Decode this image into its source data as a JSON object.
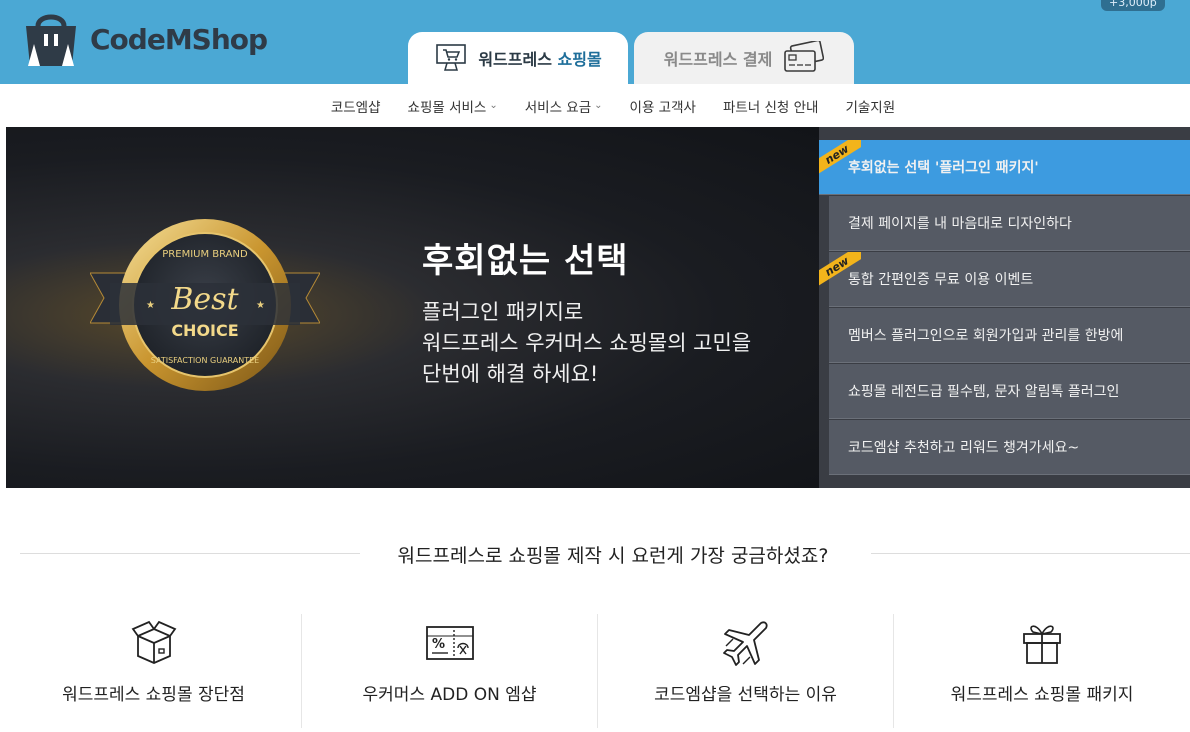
{
  "header": {
    "logo_text": "CodeMShop",
    "points_badge": "+3,000p",
    "tabs": [
      {
        "label_main": "워드프레스 ",
        "label_accent": "쇼핑몰",
        "icon": "shopping-cart-monitor-icon",
        "active": true
      },
      {
        "label_main": "워드프레스 결제",
        "icon": "payment-card-icon",
        "active": false
      }
    ]
  },
  "nav": {
    "items": [
      {
        "label": "코드엠샵",
        "dropdown": false
      },
      {
        "label": "쇼핑몰 서비스",
        "dropdown": true
      },
      {
        "label": "서비스 요금",
        "dropdown": true
      },
      {
        "label": "이용 고객사",
        "dropdown": false
      },
      {
        "label": "파트너 신청 안내",
        "dropdown": false
      },
      {
        "label": "기술지원",
        "dropdown": false
      }
    ]
  },
  "hero": {
    "title": "후회없는 선택",
    "subtitle_lines": [
      "플러그인 패키지로",
      "워드프레스 우커머스 쇼핑몰의 고민을",
      "단번에 해결 하세요!"
    ],
    "badge": {
      "top": "PREMIUM BRAND",
      "main1": "Best",
      "main2": "CHOICE",
      "bottom": "SATISFACTION GUARANTEE"
    }
  },
  "sidelist": {
    "new_label": "new",
    "items": [
      {
        "label": "후회없는 선택 '플러그인 패키지'",
        "active": true,
        "new": true
      },
      {
        "label": "결제 페이지를 내 마음대로 디자인하다",
        "active": false,
        "new": false
      },
      {
        "label": "통합 간편인증 무료 이용 이벤트",
        "active": false,
        "new": true
      },
      {
        "label": "멤버스 플러그인으로 회원가입과 관리를 한방에",
        "active": false,
        "new": false
      },
      {
        "label": "쇼핑몰 레전드급 필수템, 문자 알림톡 플러그인",
        "active": false,
        "new": false
      },
      {
        "label": "코드엠샵 추천하고 리워드 챙겨가세요~",
        "active": false,
        "new": false
      }
    ]
  },
  "section": {
    "title": "워드프레스로 쇼핑몰 제작 시 요런게 가장 궁금하셨죠?"
  },
  "features": [
    {
      "label": "워드프레스 쇼핑몰 장단점",
      "icon": "box-icon"
    },
    {
      "label": "우커머스 ADD ON 엠샵",
      "icon": "coupon-icon"
    },
    {
      "label": "코드엠샵을 선택하는 이유",
      "icon": "airplane-icon"
    },
    {
      "label": "워드프레스 쇼핑몰 패키지",
      "icon": "gift-icon"
    }
  ],
  "colors": {
    "header_bg": "#4ba8d4",
    "side_active": "#3d9be0",
    "side_item": "#555a64",
    "new_ribbon": "#f3b41b"
  }
}
